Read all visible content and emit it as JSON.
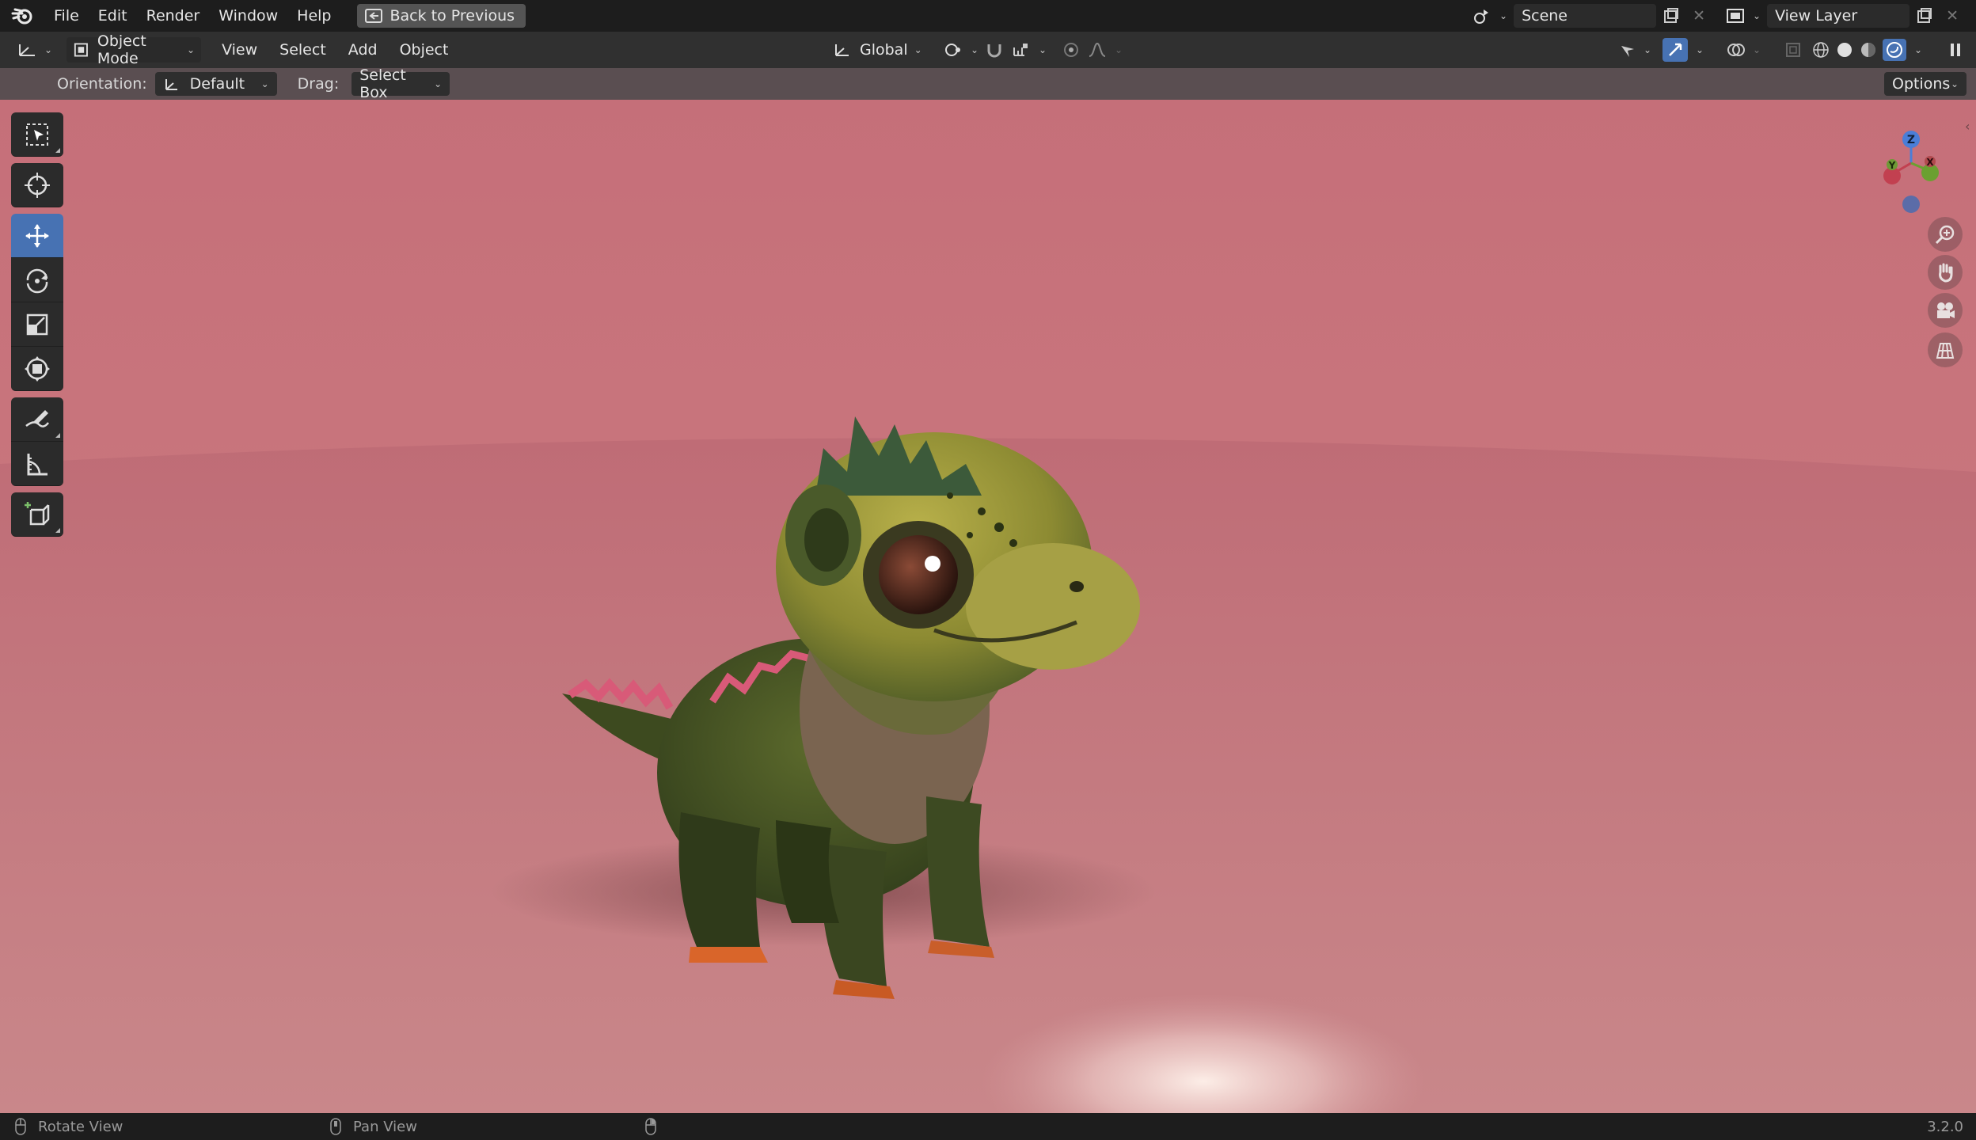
{
  "menu": {
    "items": [
      "File",
      "Edit",
      "Render",
      "Window",
      "Help"
    ],
    "back_label": "Back to Previous",
    "scene": "Scene",
    "view_layer": "View Layer"
  },
  "header": {
    "mode": "Object Mode",
    "menus": [
      "View",
      "Select",
      "Add",
      "Object"
    ],
    "transform": "Global"
  },
  "tool_settings": {
    "orientation_label": "Orientation:",
    "orientation_value": "Default",
    "drag_label": "Drag:",
    "drag_value": "Select Box",
    "options": "Options"
  },
  "gizmo": {
    "z": "Z",
    "y": "Y",
    "x": "X"
  },
  "status": {
    "rotate": "Rotate View",
    "pan": "Pan View",
    "version": "3.2.0"
  },
  "colors": {
    "accent": "#4772b3",
    "viewport_bg": "#c56f79",
    "floor": "#c2707a"
  },
  "icons": [
    "blender-logo-icon",
    "select-box-icon",
    "cursor-icon",
    "move-icon",
    "rotate-icon",
    "scale-icon",
    "transform-icon",
    "annotate-icon",
    "measure-icon",
    "add-cube-icon",
    "zoom-icon",
    "hand-icon",
    "camera-icon",
    "grid-icon"
  ]
}
